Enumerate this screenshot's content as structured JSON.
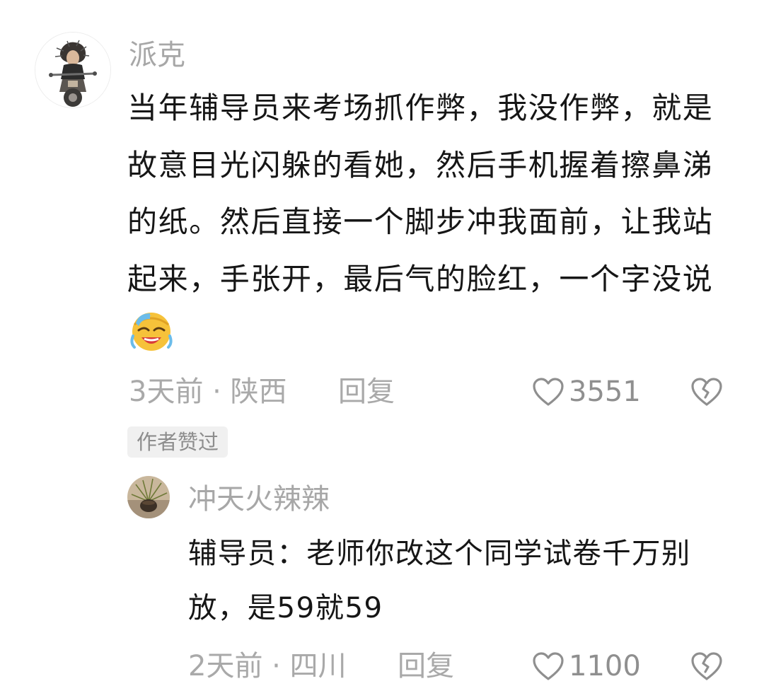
{
  "comment": {
    "author": "派克",
    "avatar_icon": "motorcycle-rider-avatar",
    "text": "当年辅导员来考场抓作弊，我没作弊，就是故意目光闪躲的看她，然后手机握着擦鼻涕的纸。然后直接一个脚步冲我面前，让我站起来，手张开，最后气的脸红，一个字没说",
    "emoji": "laughing-crying-emoji",
    "meta": "3天前 · 陕西",
    "reply_label": "回复",
    "like_count": "3551",
    "badge": "作者赞过"
  },
  "reply": {
    "author": "冲天火辣辣",
    "avatar_icon": "potted-plant-avatar",
    "text": "辅导员：老师你改这个同学试卷千万别放，是59就59",
    "meta": "2天前 · 四川",
    "reply_label": "回复",
    "like_count": "1100"
  },
  "colors": {
    "text_primary": "#161616",
    "text_secondary": "#a9a9a9",
    "badge_background": "#f0f0f0"
  }
}
